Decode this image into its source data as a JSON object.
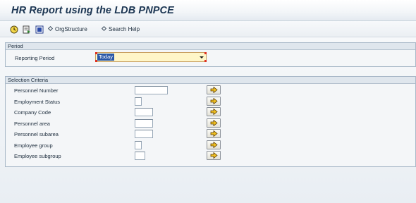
{
  "window": {
    "title": "HR Report using the LDB PNPCE"
  },
  "toolbar": {
    "execute_icon": "execute-clock-icon",
    "variant_icon": "get-variant-icon",
    "delete_icon": "delete-selection-icon",
    "org_structure_label": "OrgStructure",
    "search_help_label": "Search Help"
  },
  "period": {
    "header": "Period",
    "reporting_period_label": "Reporting Period",
    "reporting_period_value": "Today"
  },
  "selection": {
    "header": "Selection Criteria",
    "rows": [
      {
        "label": "Personnel Number",
        "value": ""
      },
      {
        "label": "Employment Status",
        "value": ""
      },
      {
        "label": "Company Code",
        "value": ""
      },
      {
        "label": "Personnel area",
        "value": ""
      },
      {
        "label": "Personnel subarea",
        "value": ""
      },
      {
        "label": "Employee group",
        "value": ""
      },
      {
        "label": "Employee subgroup",
        "value": ""
      }
    ],
    "multiple_selection_icon": "multiple-selection-arrow-icon"
  },
  "colors": {
    "title": "#1b3552",
    "dropdown_bg": "#fff6c8",
    "selection_highlight": "#2a58a8",
    "arrow_fill": "#f0c020"
  }
}
